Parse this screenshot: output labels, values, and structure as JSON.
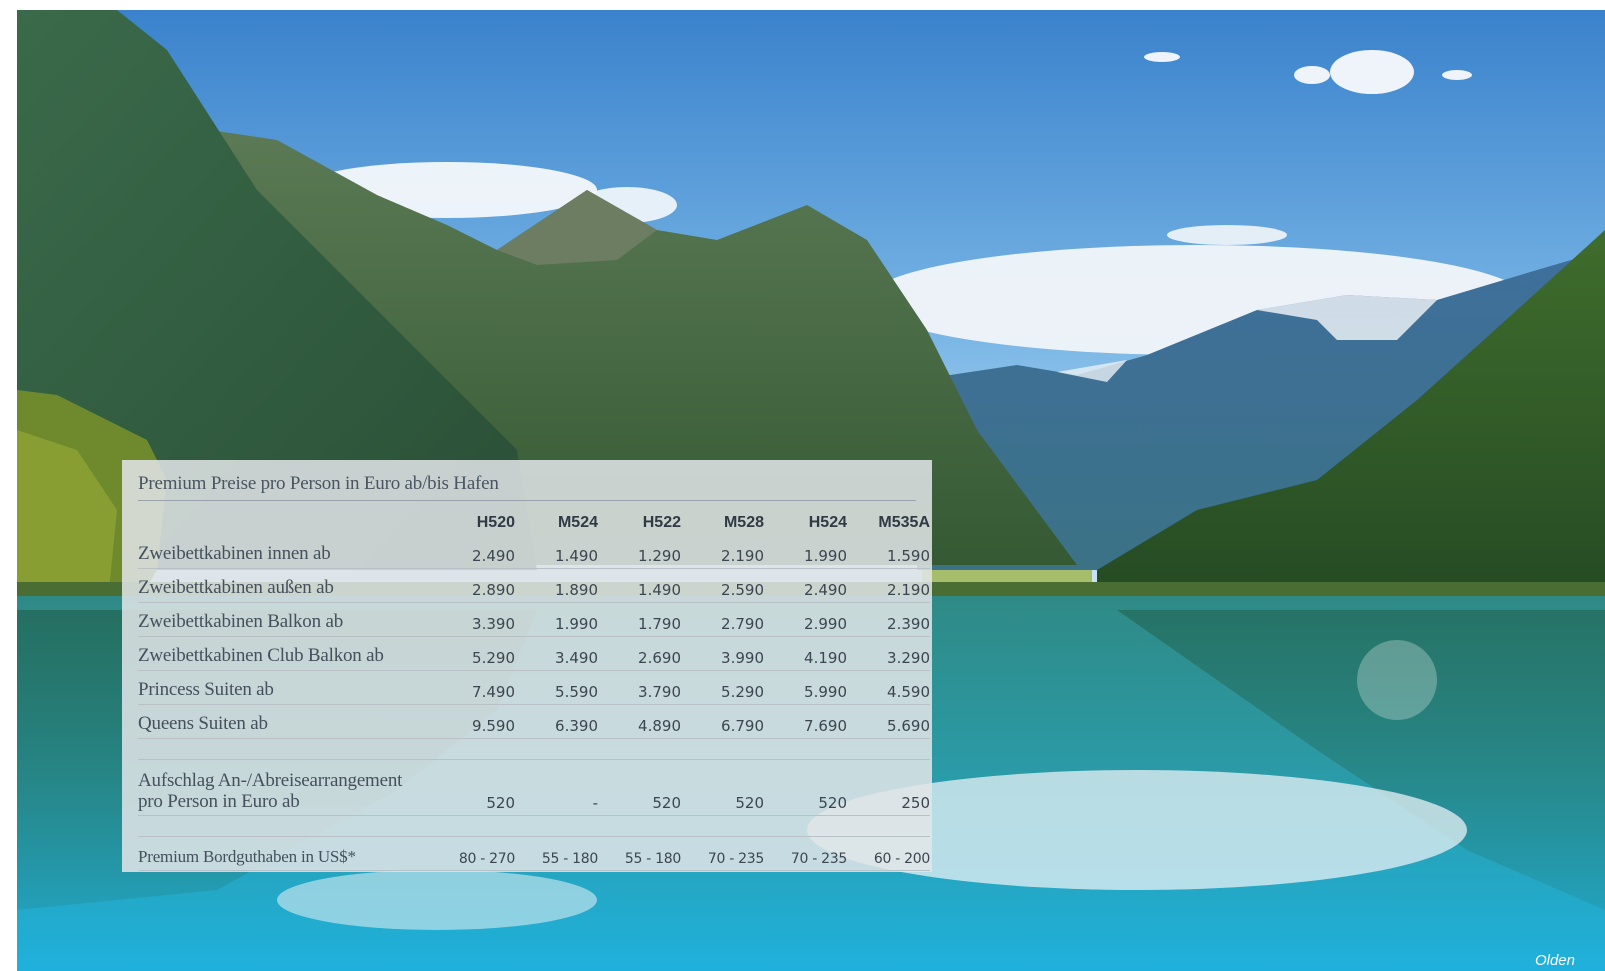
{
  "photo": {
    "subject": "fjord-landscape",
    "colors": {
      "sky_top": "#3e86cf",
      "sky_bottom": "#b9dcf3",
      "mountain_dark": "#2f5a3c",
      "mountain_green": "#4d7a3e",
      "snow_mountain": "#3c6a96",
      "water_top": "#2b8f8d",
      "water_bottom": "#22a9d6"
    }
  },
  "price_table": {
    "title": "Premium Preise pro Person in Euro ab/bis Hafen",
    "columns": [
      "H520",
      "M524",
      "H522",
      "M528",
      "H524",
      "M535A"
    ],
    "rows": [
      {
        "label": "Zweibettkabinen innen ab",
        "values": [
          "2.490",
          "1.490",
          "1.290",
          "2.190",
          "1.990",
          "1.590"
        ]
      },
      {
        "label": "Zweibettkabinen außen ab",
        "values": [
          "2.890",
          "1.890",
          "1.490",
          "2.590",
          "2.490",
          "2.190"
        ]
      },
      {
        "label": "Zweibettkabinen Balkon ab",
        "values": [
          "3.390",
          "1.990",
          "1.790",
          "2.790",
          "2.990",
          "2.390"
        ]
      },
      {
        "label": "Zweibettkabinen Club Balkon ab",
        "values": [
          "5.290",
          "3.490",
          "2.690",
          "3.990",
          "4.190",
          "3.290"
        ]
      },
      {
        "label": "Princess Suiten ab",
        "values": [
          "7.490",
          "5.590",
          "3.790",
          "5.290",
          "5.990",
          "4.590"
        ]
      },
      {
        "label": "Queens Suiten ab",
        "values": [
          "9.590",
          "6.390",
          "4.890",
          "6.790",
          "7.690",
          "5.690"
        ]
      }
    ],
    "surcharge": {
      "label_line1": "Aufschlag An-/Abreisearrangement",
      "label_line2": "pro Person in Euro ab",
      "values": [
        "520",
        "-",
        "520",
        "520",
        "520",
        "250"
      ]
    },
    "onboard_credit": {
      "label": "Premium Bordguthaben in US$*",
      "values": [
        "80 - 270",
        "55 - 180",
        "55 - 180",
        "70 - 235",
        "70 - 235",
        "60 - 200"
      ]
    }
  },
  "caption": "Olden"
}
